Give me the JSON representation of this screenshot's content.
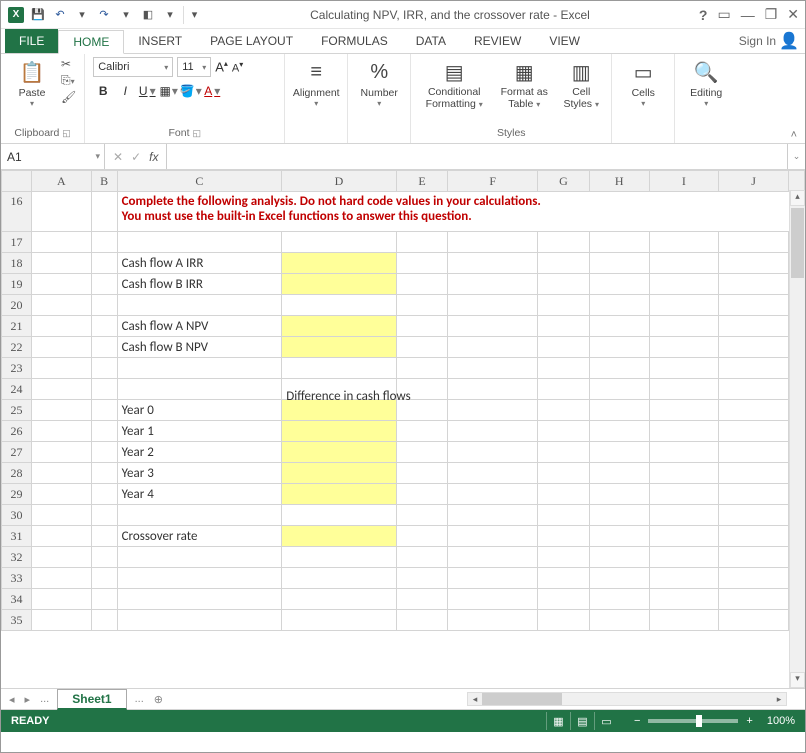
{
  "titlebar": {
    "title": "Calculating NPV, IRR, and the crossover rate - Excel",
    "help": "?"
  },
  "tabs": {
    "file": "FILE",
    "home": "HOME",
    "insert": "INSERT",
    "pagelayout": "PAGE LAYOUT",
    "formulas": "FORMULAS",
    "data": "DATA",
    "review": "REVIEW",
    "view": "VIEW",
    "signin": "Sign In"
  },
  "ribbon": {
    "clipboard": {
      "label": "Clipboard",
      "paste": "Paste"
    },
    "font": {
      "label": "Font",
      "name": "Calibri",
      "size": "11",
      "bold": "B",
      "italic": "I",
      "underline": "U",
      "grow": "Aˆ",
      "shrink": "Aˇ"
    },
    "alignment": {
      "label": "Alignment"
    },
    "number": {
      "label": "Number",
      "percent": "%"
    },
    "styles": {
      "label": "Styles",
      "cond": "Conditional Formatting",
      "fmtTable": "Format as Table",
      "cellStyles": "Cell Styles"
    },
    "cells": {
      "label": "Cells"
    },
    "editing": {
      "label": "Editing"
    }
  },
  "formulaBar": {
    "nameBox": "A1",
    "fx": "fx",
    "value": ""
  },
  "columns": [
    "A",
    "B",
    "C",
    "D",
    "E",
    "F",
    "G",
    "H",
    "I",
    "J",
    ""
  ],
  "rows": {
    "r16": {
      "num": "16",
      "instr1": "Complete the following analysis. Do not hard code values in your calculations.",
      "instr2": "You must use the built-in Excel functions to answer this question."
    },
    "r17": {
      "num": "17"
    },
    "r18": {
      "num": "18",
      "c": "Cash flow A IRR"
    },
    "r19": {
      "num": "19",
      "c": "Cash flow B IRR"
    },
    "r20": {
      "num": "20"
    },
    "r21": {
      "num": "21",
      "c": "Cash flow A NPV"
    },
    "r22": {
      "num": "22",
      "c": "Cash flow B NPV"
    },
    "r23": {
      "num": "23"
    },
    "r24": {
      "num": "24",
      "d": "Difference in cash flows"
    },
    "r25": {
      "num": "25",
      "c": "Year 0"
    },
    "r26": {
      "num": "26",
      "c": "Year 1"
    },
    "r27": {
      "num": "27",
      "c": "Year 2"
    },
    "r28": {
      "num": "28",
      "c": "Year 3"
    },
    "r29": {
      "num": "29",
      "c": "Year 4"
    },
    "r30": {
      "num": "30"
    },
    "r31": {
      "num": "31",
      "c": "Crossover rate"
    },
    "r32": {
      "num": "32"
    },
    "r33": {
      "num": "33"
    },
    "r34": {
      "num": "34"
    },
    "r35": {
      "num": "35"
    }
  },
  "sheetTabs": {
    "dots": "...",
    "sheet1": "Sheet1",
    "plus": "⊕"
  },
  "status": {
    "ready": "READY",
    "zoom": "100%"
  }
}
